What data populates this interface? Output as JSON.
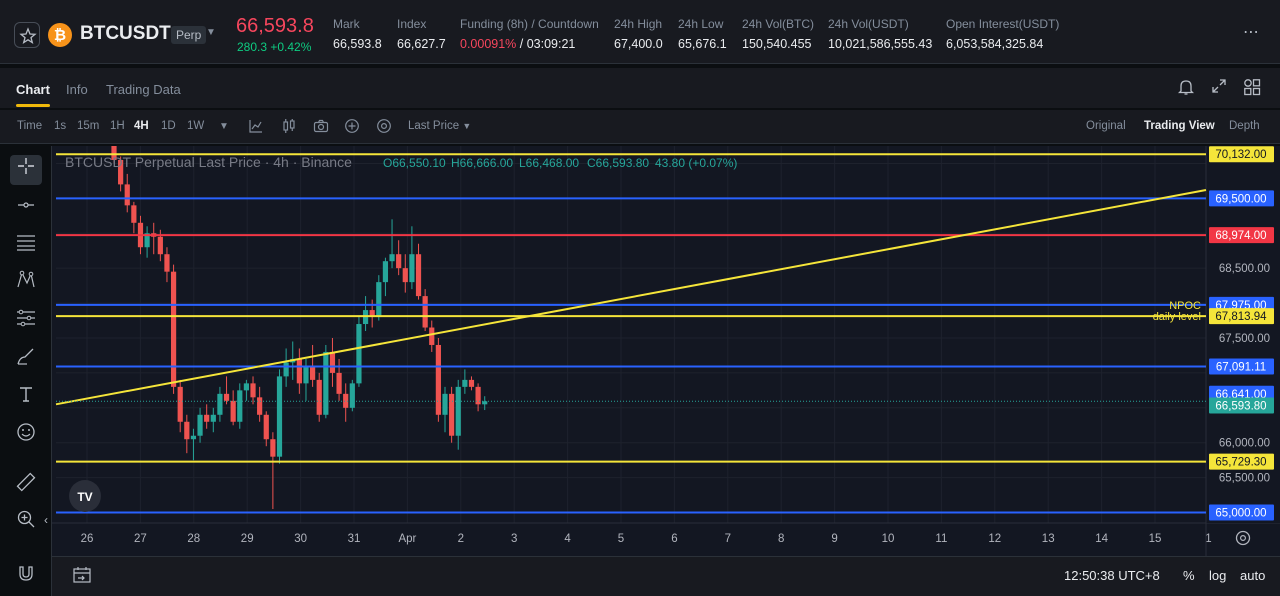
{
  "ticker": {
    "symbol": "BTCUSDT",
    "contract_badge": "Perp",
    "last_price": "66,593.8",
    "change": "280.3 +0.42%",
    "stats": [
      {
        "label": "Mark",
        "value": "66,593.8"
      },
      {
        "label": "Index",
        "value": "66,627.7"
      },
      {
        "label": "Funding (8h) / Countdown",
        "value_rate": "0.00091%",
        "value_countdown": " / 03:09:21"
      },
      {
        "label": "24h High",
        "value": "67,400.0"
      },
      {
        "label": "24h Low",
        "value": "65,676.1"
      },
      {
        "label": "24h Vol(BTC)",
        "value": "150,540.455"
      },
      {
        "label": "24h Vol(USDT)",
        "value": "10,021,586,555.43"
      },
      {
        "label": "Open Interest(USDT)",
        "value": "6,053,584,325.84"
      }
    ],
    "more_icon": "ellipsis-icon"
  },
  "tabs": [
    "Chart",
    "Info",
    "Trading Data"
  ],
  "toolbar": {
    "intervals": [
      "Time",
      "1s",
      "15m",
      "1H",
      "4H",
      "1D",
      "1W"
    ],
    "active_interval": "4H",
    "price_type": "Last Price",
    "views": [
      "Original",
      "Trading View",
      "Depth"
    ],
    "active_view": "Trading View"
  },
  "chart_title": {
    "name": "BTCUSDT Perpetual Last Price · 4h · Binance",
    "o": "O66,550.10",
    "h": "H66,666.00",
    "l": "L66,468.00",
    "c": "C66,593.80",
    "chg": "43.80 (+0.07%)"
  },
  "colors": {
    "up": "#26a69a",
    "down": "#ef5350",
    "yellow_line": "#f5e53a",
    "blue_line": "#2962ff",
    "red_line": "#f23645",
    "background": "#131722"
  },
  "chart_data": {
    "type": "candlestick",
    "y_axis_ticks": [
      "66,000.00",
      "65,500.00",
      "67,500.00",
      "68,500.00"
    ],
    "ylim": [
      64850,
      70250
    ],
    "x_axis_ticks": [
      "26",
      "27",
      "28",
      "29",
      "30",
      "31",
      "Apr",
      "2",
      "3",
      "4",
      "5",
      "6",
      "7",
      "8",
      "9",
      "10",
      "11",
      "12",
      "13",
      "14",
      "15",
      "1"
    ],
    "horizontal_levels": [
      {
        "price": 70132,
        "label": "70,132.00",
        "color": "#f5e53a"
      },
      {
        "price": 69500,
        "label": "69,500.00",
        "color": "#2962ff"
      },
      {
        "price": 68974,
        "label": "68,974.00",
        "color": "#f23645"
      },
      {
        "price": 67975,
        "label": "67,975.00",
        "color": "#2962ff",
        "annotation": "NPOC"
      },
      {
        "price": 67813.94,
        "label": "67,813.94",
        "color": "#f5e53a",
        "annotation": "daily level"
      },
      {
        "price": 67091.11,
        "label": "67,091.11",
        "color": "#2962ff"
      },
      {
        "price": 65729.3,
        "label": "65,729.30",
        "color": "#f5e53a"
      },
      {
        "price": 65000,
        "label": "65,000.00",
        "color": "#2962ff"
      }
    ],
    "price_tags": [
      {
        "price": 66641,
        "label": "66,641.00",
        "color": "#2962ff"
      },
      {
        "price": 66593.8,
        "label": "66,593.80",
        "color": "#26a69a"
      }
    ],
    "trendline": {
      "start": {
        "bar": 0,
        "price": 66550
      },
      "end": {
        "bar": 161,
        "price": 69620
      },
      "color": "#f5e53a"
    },
    "candles": [
      [
        70250,
        70250,
        70000,
        70050
      ],
      [
        70050,
        70100,
        69600,
        69700
      ],
      [
        69700,
        69850,
        69300,
        69400
      ],
      [
        69400,
        69450,
        69000,
        69150
      ],
      [
        69150,
        69250,
        68700,
        68800
      ],
      [
        68800,
        69100,
        68650,
        69000
      ],
      [
        69000,
        69150,
        68700,
        68950
      ],
      [
        68950,
        69050,
        68600,
        68700
      ],
      [
        68700,
        68800,
        68300,
        68450
      ],
      [
        68450,
        68550,
        66700,
        66800
      ],
      [
        66800,
        66900,
        66150,
        66300
      ],
      [
        66300,
        66400,
        65850,
        66050
      ],
      [
        66050,
        66200,
        65750,
        66100
      ],
      [
        66100,
        66500,
        66000,
        66400
      ],
      [
        66400,
        66550,
        66200,
        66300
      ],
      [
        66300,
        66500,
        66150,
        66400
      ],
      [
        66400,
        66800,
        66300,
        66700
      ],
      [
        66700,
        66950,
        66550,
        66600
      ],
      [
        66600,
        66750,
        66250,
        66300
      ],
      [
        66300,
        66850,
        66200,
        66750
      ],
      [
        66750,
        66900,
        66600,
        66850
      ],
      [
        66850,
        66950,
        66550,
        66650
      ],
      [
        66650,
        66800,
        66300,
        66400
      ],
      [
        66400,
        66450,
        65950,
        66050
      ],
      [
        66050,
        66150,
        65050,
        65800
      ],
      [
        65800,
        67050,
        65700,
        66950
      ],
      [
        66950,
        67350,
        66800,
        67150
      ],
      [
        67150,
        67450,
        66900,
        67200
      ],
      [
        67200,
        67350,
        66700,
        66850
      ],
      [
        66850,
        67200,
        66600,
        67100
      ],
      [
        67100,
        67400,
        66800,
        66900
      ],
      [
        66900,
        67000,
        66300,
        66400
      ],
      [
        66400,
        67400,
        66350,
        67300
      ],
      [
        67300,
        67500,
        66800,
        67000
      ],
      [
        67000,
        67200,
        66600,
        66700
      ],
      [
        66700,
        66850,
        66300,
        66500
      ],
      [
        66500,
        66900,
        66450,
        66850
      ],
      [
        66850,
        67800,
        66800,
        67700
      ],
      [
        67700,
        68100,
        67600,
        67900
      ],
      [
        67900,
        68050,
        67650,
        67800
      ],
      [
        67800,
        68400,
        67750,
        68300
      ],
      [
        68300,
        68650,
        68100,
        68600
      ],
      [
        68600,
        69200,
        68500,
        68700
      ],
      [
        68700,
        68900,
        68400,
        68500
      ],
      [
        68500,
        68700,
        68150,
        68300
      ],
      [
        68300,
        69100,
        68200,
        68700
      ],
      [
        68700,
        68850,
        68050,
        68100
      ],
      [
        68100,
        68200,
        67600,
        67650
      ],
      [
        67650,
        67750,
        67300,
        67400
      ],
      [
        67400,
        67500,
        66300,
        66400
      ],
      [
        66400,
        66800,
        66150,
        66700
      ],
      [
        66700,
        66800,
        66000,
        66100
      ],
      [
        66100,
        66900,
        65900,
        66800
      ],
      [
        66800,
        67050,
        66700,
        66900
      ],
      [
        66900,
        66950,
        66750,
        66800
      ],
      [
        66800,
        66850,
        66450,
        66550
      ],
      [
        66550,
        66666,
        66468,
        66593.8
      ]
    ]
  },
  "side_tools": [
    "crosshair-icon",
    "horizontal-line-icon",
    "fib-icon",
    "pattern-icon",
    "projection-icon",
    "brush-icon",
    "text-icon",
    "emoji-icon",
    "ruler-icon",
    "zoom-in-icon",
    "magnet-icon"
  ],
  "footer": {
    "time": "12:50:38 UTC+8",
    "percent": "%",
    "log": "log",
    "auto": "auto"
  }
}
